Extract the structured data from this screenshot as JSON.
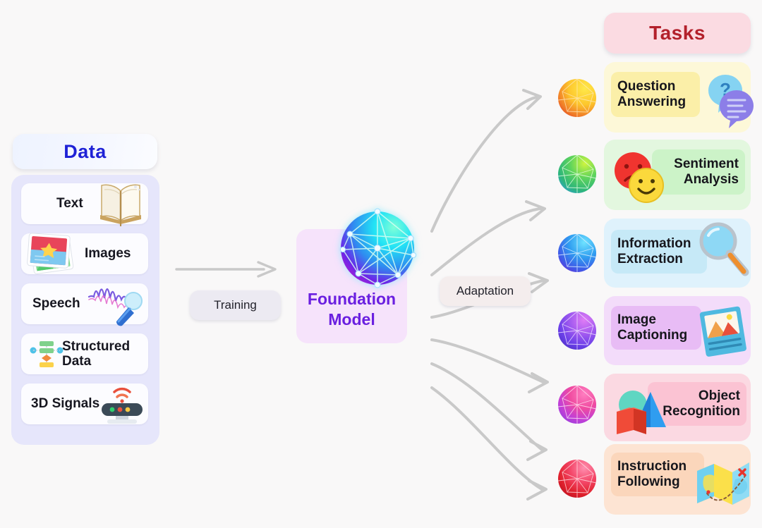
{
  "diagram": {
    "title_left": "Data",
    "title_right": "Tasks",
    "center_label_line1": "Foundation",
    "center_label_line2": "Model",
    "edge_labels": {
      "training": "Training",
      "adaptation": "Adaptation"
    },
    "background_color": "#f9f8f8"
  },
  "data_panel": {
    "header": "Data",
    "header_color": "#1f22d6",
    "panel_color": "#e6e6fb",
    "items": [
      {
        "label": "Text",
        "icon": "open-book-icon",
        "icon_side": "right"
      },
      {
        "label": "Images",
        "icon": "photos-icon",
        "icon_side": "left"
      },
      {
        "label": "Speech",
        "icon": "waveform-mic-icon",
        "icon_side": "right"
      },
      {
        "label": "Structured\nData",
        "label_line1": "Structured",
        "label_line2": "Data",
        "icon": "flowchart-icon",
        "icon_side": "left"
      },
      {
        "label": "3D Signals",
        "icon": "lidar-sensor-icon",
        "icon_side": "right"
      }
    ]
  },
  "center": {
    "label_line1": "Foundation",
    "label_line2": "Model",
    "card_color": "#f6e3fb",
    "text_color": "#6a1fe0",
    "icon": "network-sphere-icon"
  },
  "tasks_panel": {
    "header": "Tasks",
    "header_color": "#b3202b",
    "header_bg": "#fbdbe2",
    "tasks": [
      {
        "line1": "Question",
        "line2": "Answering",
        "card_color": "#fdf8d8",
        "band_color": "#fbeFA8",
        "sphere": "yellow-orange-sphere-icon",
        "icon": "speech-bubbles-icon",
        "text_align": "left",
        "icon_side": "right"
      },
      {
        "line1": "Sentiment",
        "line2": "Analysis",
        "card_color": "#e3f7df",
        "band_color": "#ccf3c8",
        "sphere": "green-sphere-icon",
        "icon": "emoji-faces-icon",
        "text_align": "right",
        "icon_side": "left"
      },
      {
        "line1": "Information",
        "line2": "Extraction",
        "card_color": "#dff2fc",
        "band_color": "#c6e9f7",
        "sphere": "blue-sphere-icon",
        "icon": "magnifying-glass-icon",
        "text_align": "left",
        "icon_side": "right"
      },
      {
        "line1": "Image",
        "line2": "Captioning",
        "card_color": "#f3dcfa",
        "band_color": "#e8bcf5",
        "sphere": "purple-sphere-icon",
        "icon": "picture-card-icon",
        "text_align": "left",
        "icon_side": "right"
      },
      {
        "line1": "Object",
        "line2": "Recognition",
        "card_color": "#fbd9e2",
        "band_color": "#fbc3d3",
        "sphere": "magenta-sphere-icon",
        "icon": "3d-shapes-icon",
        "text_align": "right",
        "icon_side": "left"
      },
      {
        "line1": "Instruction",
        "line2": "Following",
        "card_color": "#fde4d3",
        "band_color": "#fbd6bb",
        "sphere": "red-sphere-icon",
        "icon": "folded-map-icon",
        "text_align": "left",
        "icon_side": "right"
      }
    ]
  },
  "arrows": {
    "training_arrow": "straight-arrow-right",
    "adaptation_arrows": "curved-arrow-right",
    "color": "#c9c9c9",
    "count": 6
  }
}
